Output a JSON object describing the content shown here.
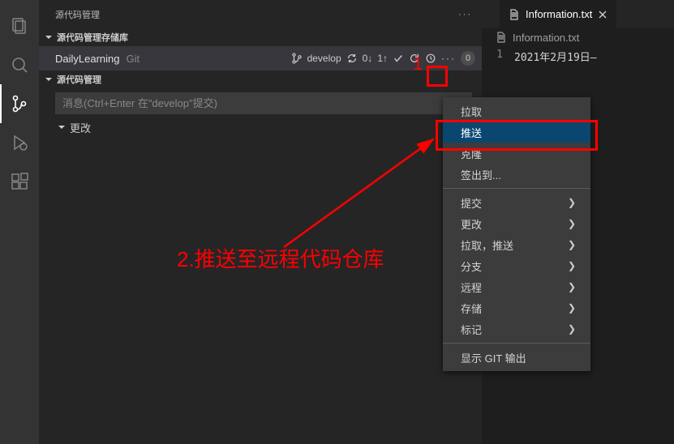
{
  "sidebar": {
    "title": "源代码管理",
    "section_repos": "源代码管理存储库",
    "section_scm": "源代码管理",
    "repo": {
      "name": "DailyLearning",
      "vcs": "Git",
      "branch": "develop",
      "incoming": "0↓",
      "outgoing": "1↑",
      "badge": "0"
    },
    "commit_placeholder": "消息(Ctrl+Enter 在\"develop\"提交)",
    "changes_label": "更改"
  },
  "editor": {
    "tab_name": "Information.txt",
    "breadcrumb": "Information.txt",
    "line_number": "1",
    "content": "2021年2月19日—"
  },
  "menu": {
    "pull": "拉取",
    "push": "推送",
    "clone": "克隆",
    "checkout_to": "签出到...",
    "commit": "提交",
    "changes": "更改",
    "pull_push": "拉取，推送",
    "branch": "分支",
    "remote": "远程",
    "stash": "存储",
    "tag": "标记",
    "show_git_output": "显示 GIT 输出"
  },
  "annotation": {
    "label1": "1",
    "label2": "2.推送至远程代码仓库"
  }
}
